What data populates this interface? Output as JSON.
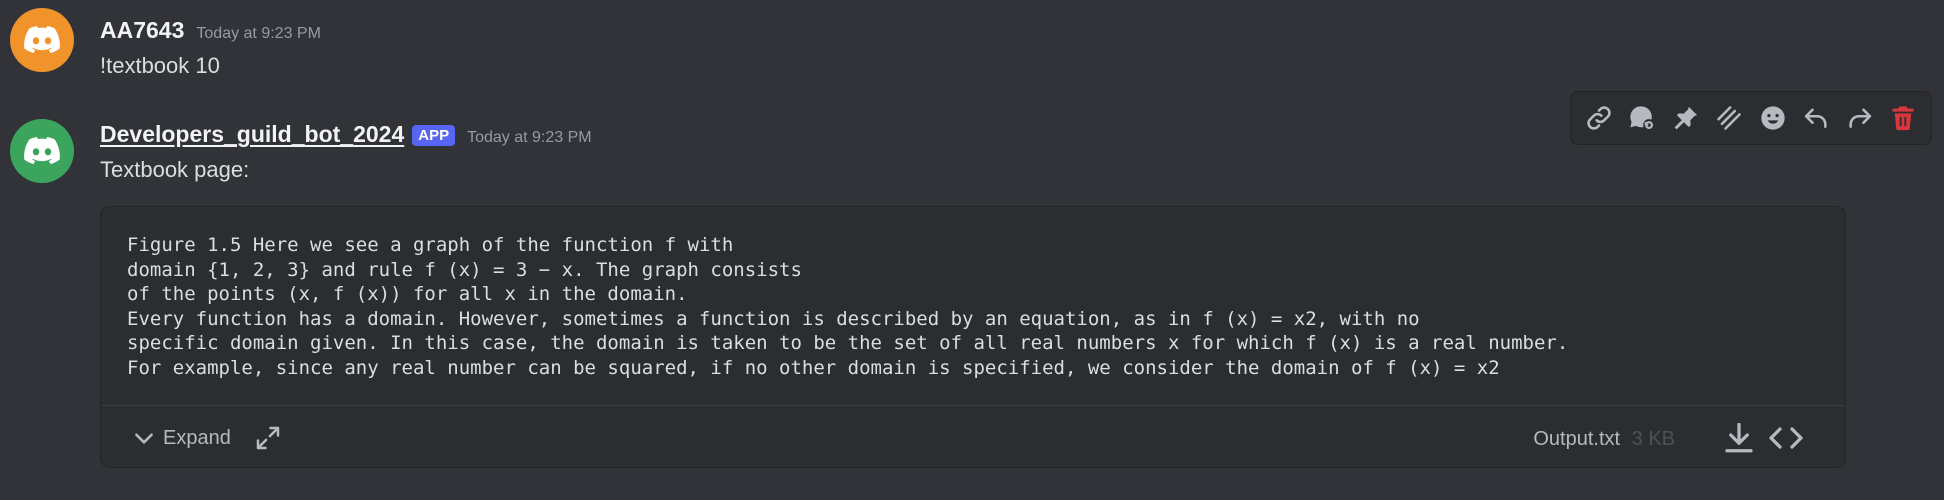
{
  "messages": [
    {
      "author": "AA7643",
      "timestamp": "Today at 9:23 PM",
      "avatar_color": "#f0932b",
      "avatar_icon": "discord-logo",
      "text": "!textbook 10"
    },
    {
      "author": "Developers_guild_bot_2024",
      "badge": "APP",
      "timestamp": "Today at 9:23 PM",
      "avatar_color": "#3ba55d",
      "avatar_icon": "discord-logo",
      "text": "Textbook page:",
      "attachment": {
        "lines": [
          "Figure 1.5 Here we see a graph of the function f with",
          "domain {1, 2, 3} and rule f (x) = 3 − x. The graph consists",
          "of the points (x, f (x)) for all x in the domain.",
          "Every function has a domain. However, sometimes a function is described by an equation, as in f (x) = x2, with no",
          "specific domain given. In this case, the domain is taken to be the set of all real numbers x for which f (x) is a real number.",
          "For example, since any real number can be squared, if no other domain is specified, we consider the domain of f (x) = x2"
        ],
        "expand_label": "Expand",
        "file_name": "Output.txt",
        "file_size": "3 KB"
      }
    }
  ],
  "toolbar": {
    "icons": [
      "link-icon",
      "thread-icon",
      "pin-icon",
      "slash-icon",
      "emoji-icon",
      "reply-icon",
      "forward-icon",
      "delete-icon"
    ],
    "delete_color": "#da373c"
  },
  "colors": {
    "background": "#313338",
    "accent": "#5865f2"
  }
}
